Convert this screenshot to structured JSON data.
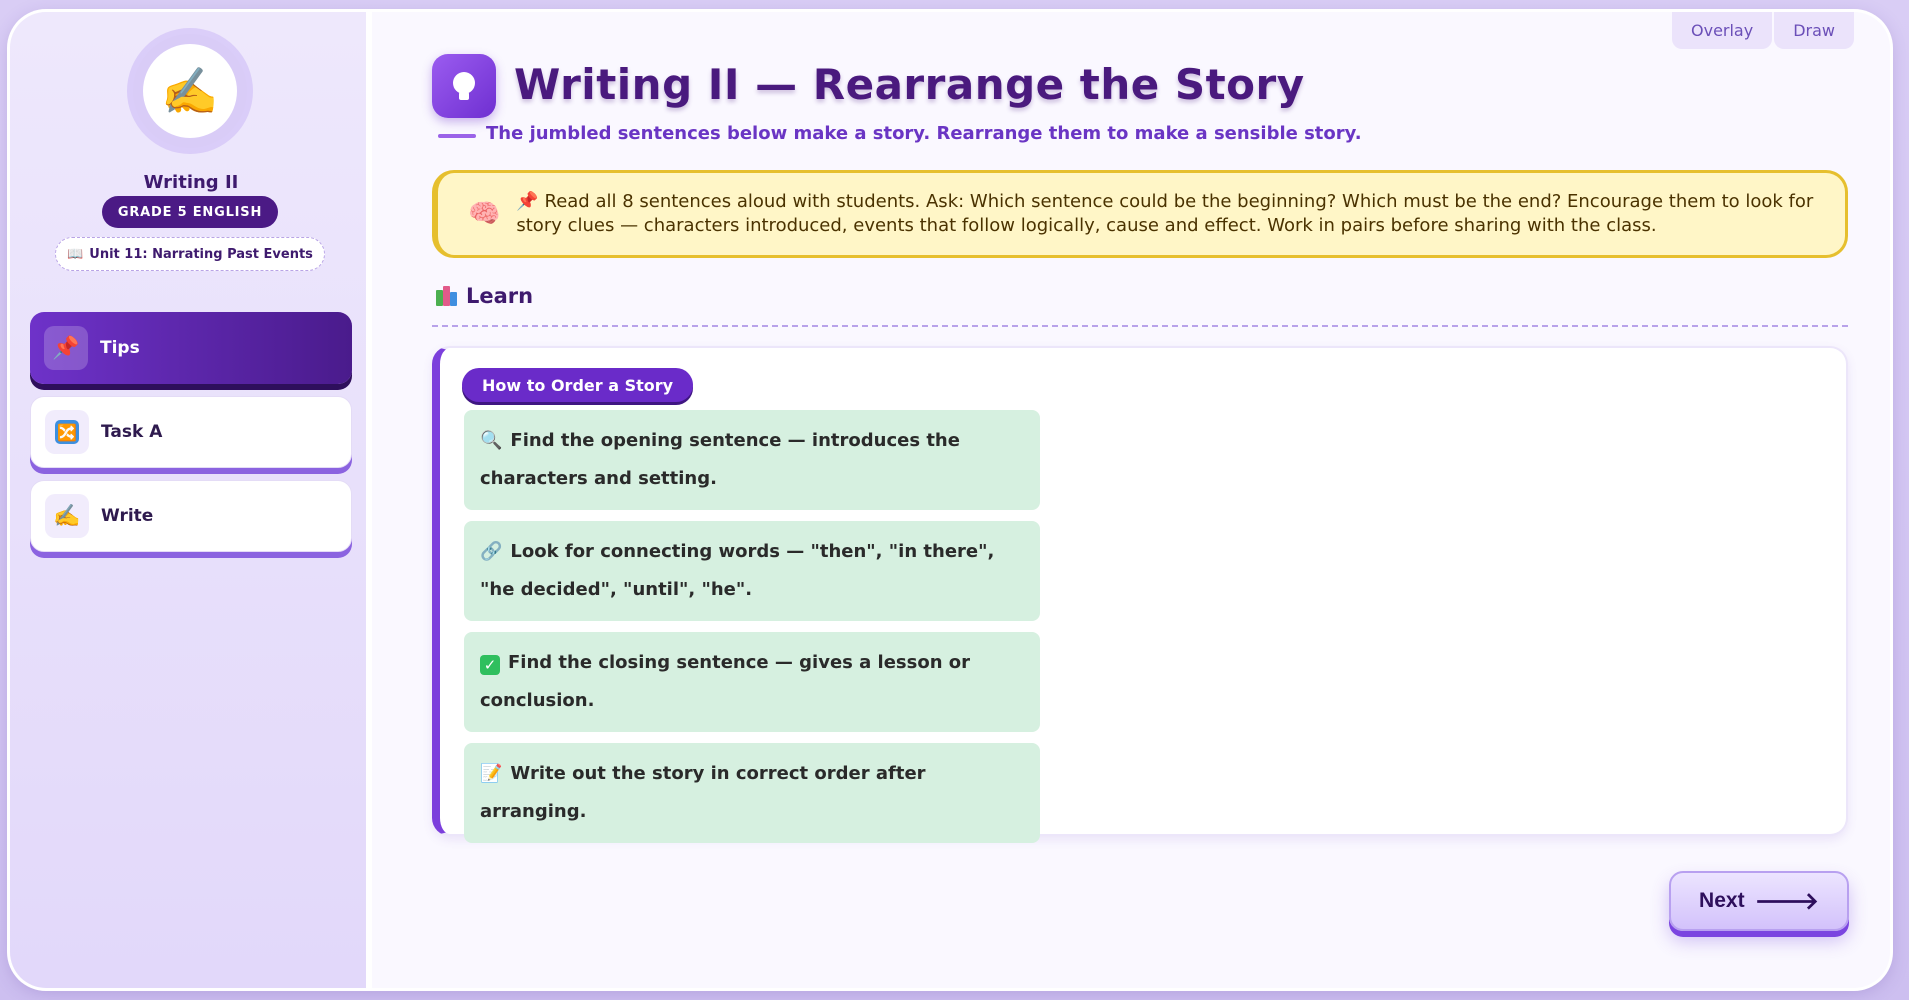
{
  "topbar": {
    "overlay_label": "Overlay",
    "draw_label": "Draw"
  },
  "sidebar": {
    "avatar_emoji": "✍️",
    "title": "Writing II",
    "grade": "GRADE 5 ENGLISH",
    "unit_icon": "📖",
    "unit": "Unit 11: Narrating Past Events",
    "items": [
      {
        "icon": "📌",
        "label": "Tips",
        "active": true
      },
      {
        "icon": "🔀",
        "label": "Task A",
        "active": false
      },
      {
        "icon": "✍️",
        "label": "Write",
        "active": false
      }
    ]
  },
  "main": {
    "title": "Writing II — Rearrange the Story",
    "subtitle": "The jumbled sentences below make a story. Rearrange them to make a sensible story.",
    "note": {
      "icon": "🧠",
      "text": "📌 Read all 8 sentences aloud with students. Ask: Which sentence could be the beginning? Which must be the end? Encourage them to look for story clues — characters introduced, events that follow logically, cause and effect. Work in pairs before sharing with the class."
    },
    "learn_label": "Learn",
    "card": {
      "title": "How to Order a Story",
      "tips": [
        {
          "icon": "🔍",
          "text": "Find the opening sentence — introduces the characters and setting."
        },
        {
          "icon": "🔗",
          "text": "Look for connecting words — \"then\", \"in there\", \"he decided\", \"until\", \"he\"."
        },
        {
          "icon": "✓",
          "text": "Find the closing sentence — gives a lesson or conclusion."
        },
        {
          "icon": "📝",
          "text": "Write out the story in correct order after arranging."
        }
      ]
    },
    "next_label": "Next",
    "next_arrow": "🡒"
  },
  "colors": {
    "accent": "#6a2bc9",
    "tip_bg": "#d6f0e0",
    "note_bg": "#fff6c7",
    "note_border": "#e6bf2e"
  }
}
